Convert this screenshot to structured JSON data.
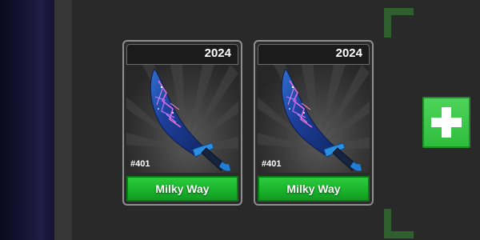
{
  "inventory": {
    "items": [
      {
        "year": "2024",
        "serial": "#401",
        "name": "Milky Way",
        "icon": "milky-way-knife-icon"
      },
      {
        "year": "2024",
        "serial": "#401",
        "name": "Milky Way",
        "icon": "milky-way-knife-icon"
      }
    ]
  },
  "add_button": {
    "icon": "plus-icon"
  },
  "colors": {
    "name_button": "#19b12a",
    "add_button": "#2fbd3d",
    "bracket": "#2f5e2f",
    "background": "#272727"
  }
}
